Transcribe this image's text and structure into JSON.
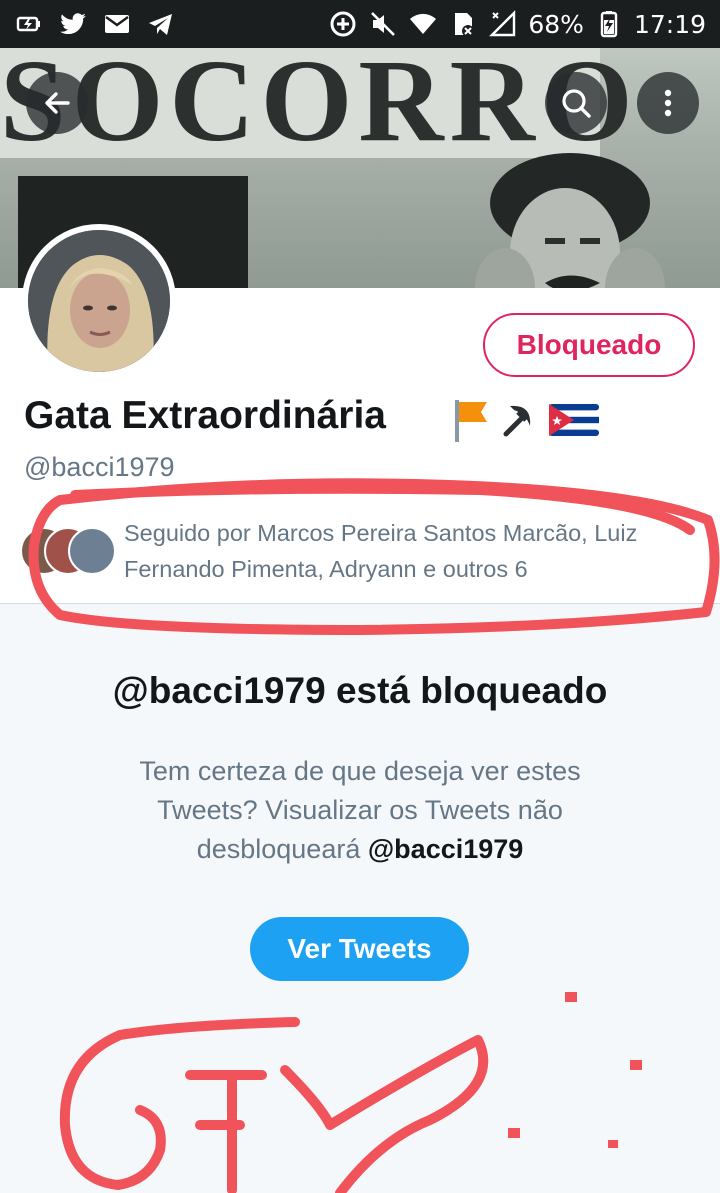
{
  "status_bar": {
    "battery": "68%",
    "time": "17:19"
  },
  "banner": {
    "sign_text": "SOCORRO"
  },
  "profile": {
    "display_name": "Gata Extraordinária",
    "handle": "@bacci1979",
    "block_button": "Bloqueado",
    "followed_by": "Seguido por Marcos Pereira Santos Marcão, Luiz Fernando Pimenta, Adryann e outros 6"
  },
  "blocked_notice": {
    "title": "@bacci1979 está bloqueado",
    "desc_text": "Tem certeza de que deseja ver estes Tweets? Visualizar os Tweets não desbloqueará",
    "desc_handle": "@bacci1979",
    "button": "Ver Tweets"
  },
  "colors": {
    "accent_blue": "#1da1f2",
    "blocked_red": "#e0245e",
    "annotation_red": "#f0545a",
    "status_bar_bg": "#1b1e1f"
  },
  "icons": [
    "battery-saver-icon",
    "twitter-icon",
    "mail-icon",
    "telegram-icon",
    "data-saver-icon",
    "mute-icon",
    "wifi-icon",
    "sim-icon",
    "signal-icon",
    "battery-icon",
    "back-arrow-icon",
    "search-icon",
    "more-vert-icon"
  ]
}
